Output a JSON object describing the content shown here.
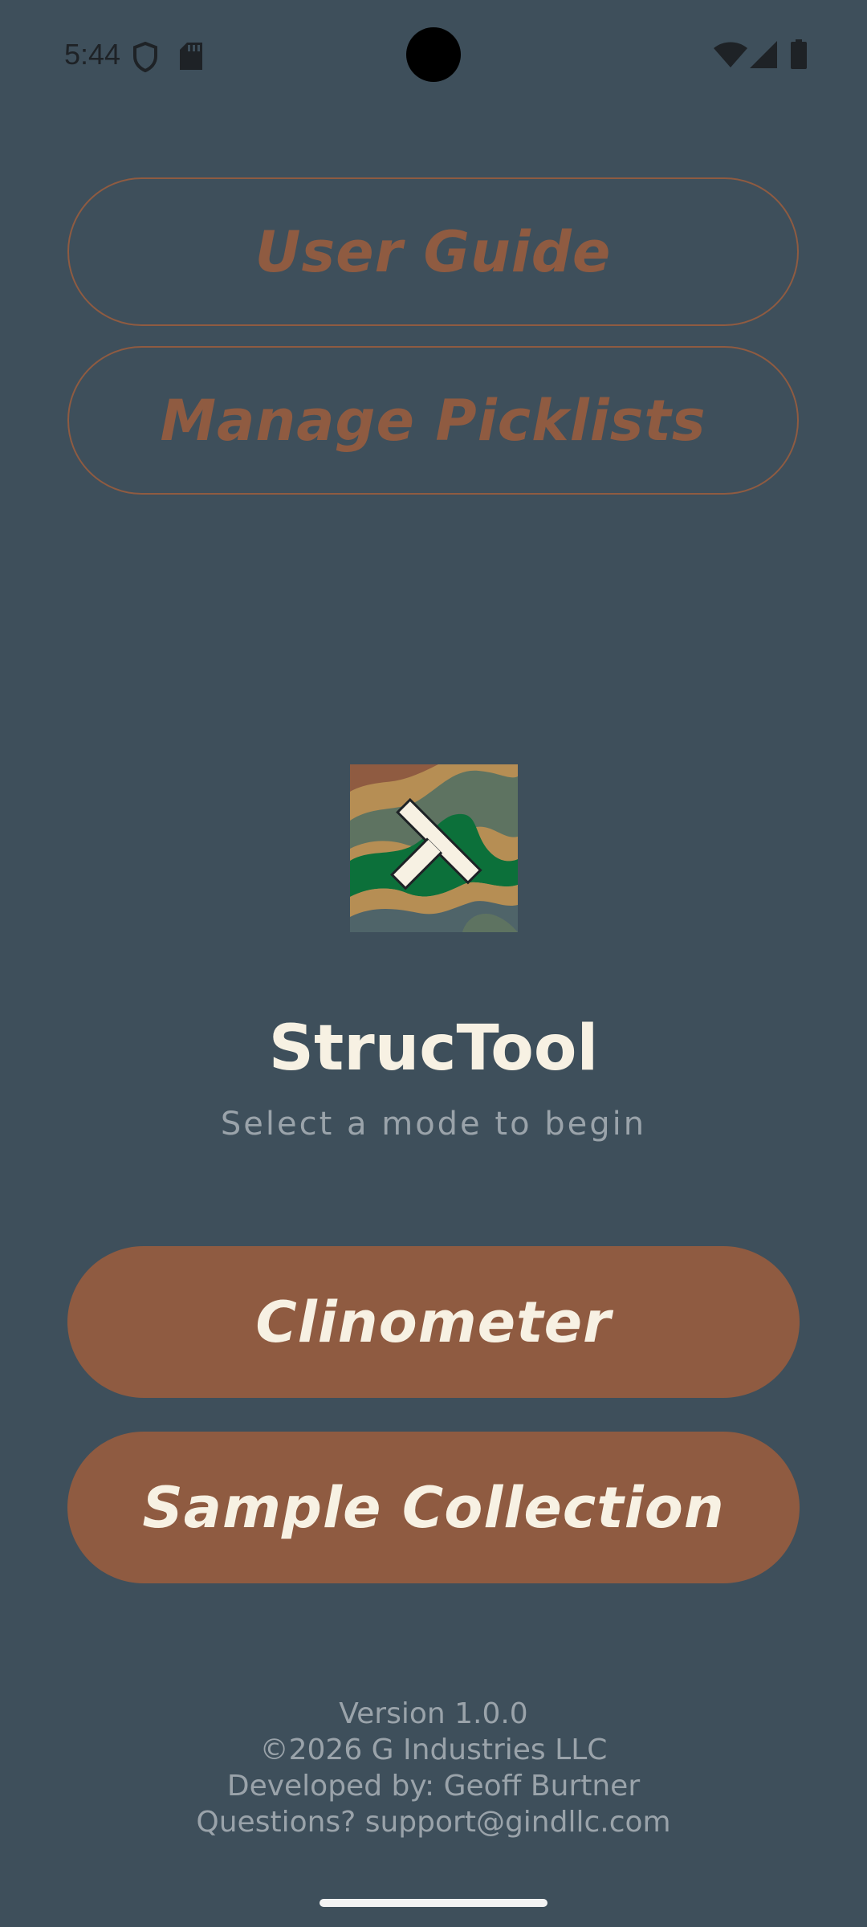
{
  "status_bar": {
    "time": "5:44",
    "icons": [
      "shield-icon",
      "sd-card-icon",
      "wifi-icon",
      "cellular-signal-icon",
      "battery-icon"
    ]
  },
  "top_buttons": {
    "user_guide": "User Guide",
    "manage_picklists": "Manage Picklists"
  },
  "app": {
    "logo": "structool-logo",
    "title": "StrucTool",
    "subtitle": "Select a mode to begin"
  },
  "mode_buttons": {
    "clinometer": "Clinometer",
    "sample_collection": "Sample Collection"
  },
  "footer": {
    "version": "Version 1.0.0",
    "copyright": "©2026 G Industries LLC",
    "developer": "Developed by: Geoff Burtner",
    "contact": "Questions? support@gindllc.com"
  },
  "colors": {
    "background": "#3e4f5b",
    "accent": "#8f5b41",
    "title_text": "#f7f1e3",
    "muted_text": "#9aa3aa"
  }
}
